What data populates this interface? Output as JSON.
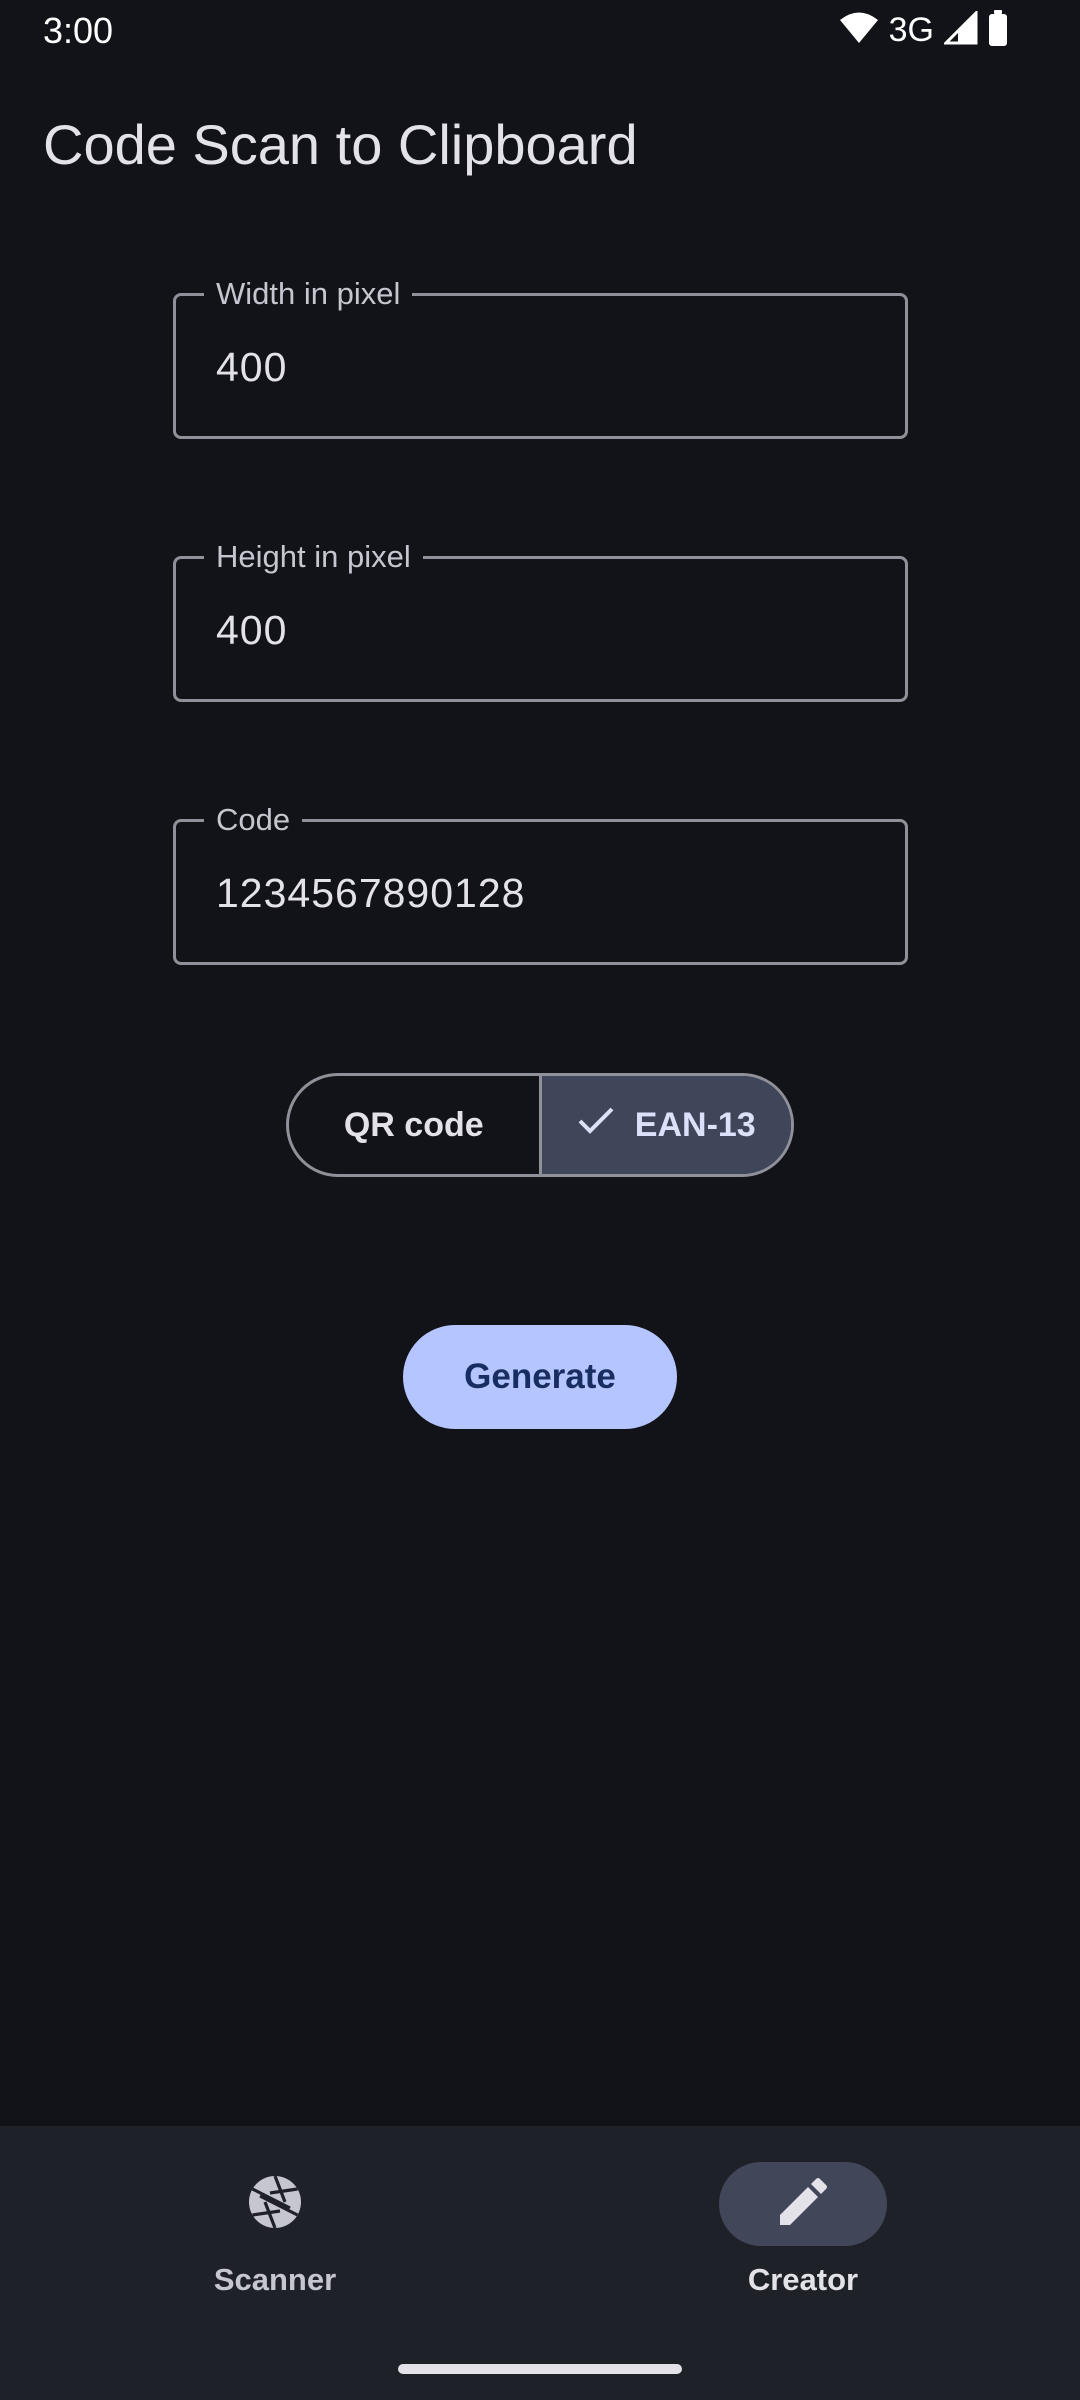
{
  "status_bar": {
    "time": "3:00",
    "network": "3G",
    "icons": [
      "wifi-icon",
      "signal-icon",
      "battery-icon"
    ]
  },
  "app": {
    "title": "Code Scan to Clipboard"
  },
  "form": {
    "width": {
      "label": "Width in pixel",
      "value": "400"
    },
    "height": {
      "label": "Height in pixel",
      "value": "400"
    },
    "code": {
      "label": "Code",
      "value": "1234567890128"
    }
  },
  "format_toggle": {
    "options": [
      {
        "label": "QR code",
        "selected": false
      },
      {
        "label": "EAN-13",
        "selected": true
      }
    ]
  },
  "generate_button": {
    "label": "Generate"
  },
  "bottom_nav": {
    "items": [
      {
        "label": "Scanner",
        "icon": "aperture-icon",
        "active": false
      },
      {
        "label": "Creator",
        "icon": "pencil-icon",
        "active": true
      }
    ]
  },
  "colors": {
    "background": "#121318",
    "primary": "#b4c5ff",
    "on_primary": "#182e60",
    "selected_segment": "#404659",
    "nav_background": "#1f2129",
    "outline": "#8f909a"
  }
}
